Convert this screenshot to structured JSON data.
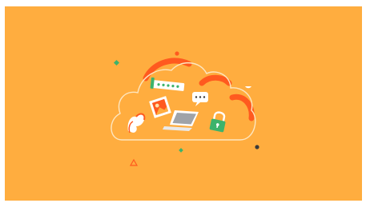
{
  "scene": {
    "type": "cloud-services-illustration",
    "colors": {
      "background": "#ffad3f",
      "frame": "#ffffff",
      "cloud_outline": "#fde6c0",
      "cloud_accent": "#ff5a1f",
      "green": "#3db36b",
      "dark": "#3a3a3a",
      "white": "#ffffff"
    },
    "icons": [
      "cloud-icon",
      "password-field-icon",
      "chat-bubble-icon",
      "photo-icon",
      "laptop-icon",
      "flexed-arm-icon",
      "padlock-icon"
    ],
    "password_dots": 5,
    "chat_dots": 3
  }
}
